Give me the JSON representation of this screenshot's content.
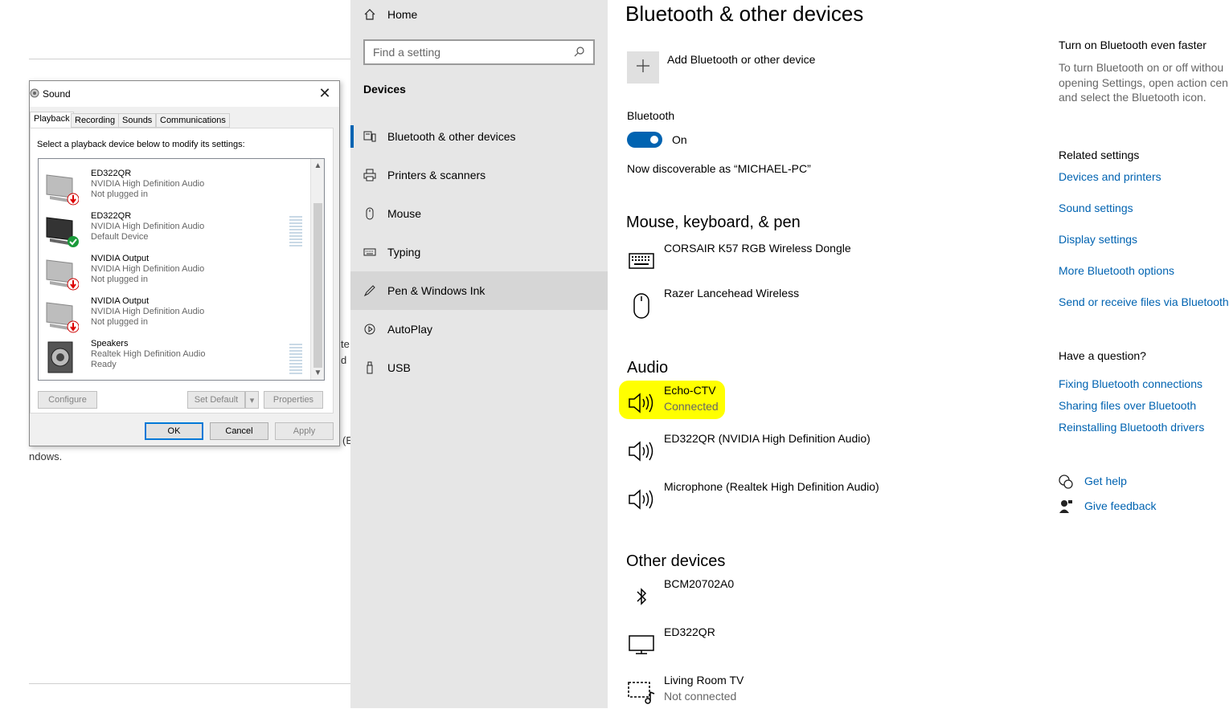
{
  "background_doc": {
    "fragment_ed": "(E",
    "fragment_windows": "ndows.",
    "fragment_ted": "te",
    "fragment_d": "d"
  },
  "nav": {
    "home": "Home",
    "search_placeholder": "Find a setting",
    "section": "Devices",
    "items": [
      {
        "label": "Bluetooth & other devices",
        "icon": "bluetooth-devices-icon"
      },
      {
        "label": "Printers & scanners",
        "icon": "printer-icon"
      },
      {
        "label": "Mouse",
        "icon": "mouse-icon"
      },
      {
        "label": "Typing",
        "icon": "keyboard-icon"
      },
      {
        "label": "Pen & Windows Ink",
        "icon": "pen-icon"
      },
      {
        "label": "AutoPlay",
        "icon": "autoplay-icon"
      },
      {
        "label": "USB",
        "icon": "usb-icon"
      }
    ]
  },
  "main": {
    "title": "Bluetooth & other devices",
    "add_device": "Add Bluetooth or other device",
    "bluetooth_label": "Bluetooth",
    "bluetooth_state": "On",
    "discoverable": "Now discoverable as “MICHAEL-PC”",
    "mkp_heading": "Mouse, keyboard, & pen",
    "mkp_devices": [
      {
        "name": "CORSAIR K57 RGB Wireless Dongle"
      },
      {
        "name": "Razer Lancehead Wireless"
      }
    ],
    "audio_heading": "Audio",
    "audio_devices": [
      {
        "name": "Echo-CTV",
        "status": "Connected"
      },
      {
        "name": "ED322QR (NVIDIA High Definition Audio)"
      },
      {
        "name": "Microphone (Realtek High Definition Audio)"
      }
    ],
    "other_heading": "Other devices",
    "other_devices": [
      {
        "name": "BCM20702A0"
      },
      {
        "name": "ED322QR"
      },
      {
        "name": "Living Room TV",
        "status": "Not connected"
      }
    ]
  },
  "side": {
    "faster_heading": "Turn on Bluetooth even faster",
    "faster_text_1": "To turn Bluetooth on or off withou",
    "faster_text_2": "opening Settings, open action cen",
    "faster_text_3": "and select the Bluetooth icon.",
    "related_heading": "Related settings",
    "related_links": [
      "Devices and printers",
      "Sound settings",
      "Display settings",
      "More Bluetooth options",
      "Send or receive files via Bluetooth"
    ],
    "question_heading": "Have a question?",
    "question_links": [
      "Fixing Bluetooth connections",
      "Sharing files over Bluetooth",
      "Reinstalling Bluetooth drivers"
    ],
    "get_help": "Get help",
    "give_feedback": "Give feedback"
  },
  "sound_dialog": {
    "title": "Sound",
    "tabs": [
      "Playback",
      "Recording",
      "Sounds",
      "Communications"
    ],
    "instruction": "Select a playback device below to modify its settings:",
    "devices": [
      {
        "name": "ED322QR",
        "driver": "NVIDIA High Definition Audio",
        "status": "Not plugged in"
      },
      {
        "name": "ED322QR",
        "driver": "NVIDIA High Definition Audio",
        "status": "Default Device"
      },
      {
        "name": "NVIDIA Output",
        "driver": "NVIDIA High Definition Audio",
        "status": "Not plugged in"
      },
      {
        "name": "NVIDIA Output",
        "driver": "NVIDIA High Definition Audio",
        "status": "Not plugged in"
      },
      {
        "name": "Speakers",
        "driver": "Realtek High Definition Audio",
        "status": "Ready"
      }
    ],
    "configure": "Configure",
    "set_default": "Set Default",
    "properties": "Properties",
    "ok": "OK",
    "cancel": "Cancel",
    "apply": "Apply"
  },
  "colors": {
    "accent": "#0063b1",
    "highlight": "#ffff00",
    "nav_bg": "#e6e6e6"
  }
}
